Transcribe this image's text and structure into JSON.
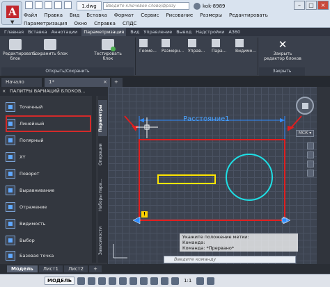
{
  "titlebar": {
    "doc_tab": "1.dwg",
    "search_placeholder": "Введите ключевое слово/фразу",
    "user": "kok-8989",
    "menus": [
      "Файл",
      "Правка",
      "Вид",
      "Вставка",
      "Формат",
      "Сервис",
      "Рисование",
      "Размеры",
      "Редактировать",
      "Параметризация",
      "Окно",
      "Справка",
      "СПДС"
    ]
  },
  "ribbon_tabs": [
    "Главная",
    "Вставка",
    "Аннотации",
    "Параметризация",
    "Вид",
    "Управление",
    "Вывод",
    "Надстройки",
    "A360"
  ],
  "ribbon": {
    "btn_edit_block": "Редактировать блок",
    "btn_save_block": "Сохранить блок",
    "btn_test_block": "Тестировать блок",
    "btn_geom": "Геоме...",
    "btn_dims": "Размерн...",
    "btn_manage": "Управ...",
    "btn_param": "Пара...",
    "btn_vis": "Видимо...",
    "btn_close_editor": "Закрыть редактор блоков",
    "group_open_save": "Открыть/Сохранить",
    "group_close": "Закрыть"
  },
  "filetabs": {
    "start": "Начало",
    "doc": "1*",
    "close": "×",
    "plus": "+"
  },
  "palette": {
    "title": "ПАЛИТРЫ ВАРИАЦИЙ БЛОКОВ...",
    "items": [
      "Точечный",
      "Линейный",
      "Полярный",
      "XY",
      "Поворот",
      "Выравнивание",
      "Отражение",
      "Видимость",
      "Выбор",
      "Базовая точка"
    ],
    "vtabs": [
      "Параметры",
      "Операции",
      "Наборы пара...",
      "Зависимости"
    ]
  },
  "drawing": {
    "dimension_label": "Расстояние1",
    "warn_mark": "!",
    "cmd_lines": [
      "Укажите положение метки:",
      "Команда:",
      "Команда: *Прервано*"
    ],
    "cmd_placeholder": "Введите команду",
    "msk": "МСК",
    "colors": {
      "red": "#e01e1e",
      "yellow": "#ffe600",
      "cyan": "#1ee0e6",
      "dim_blue": "#2f8cff"
    }
  },
  "layout_tabs": [
    "Модель",
    "Лист1",
    "Лист2",
    "+"
  ],
  "statusbar": {
    "model": "МОДЕЛЬ",
    "scale": "1:1"
  }
}
